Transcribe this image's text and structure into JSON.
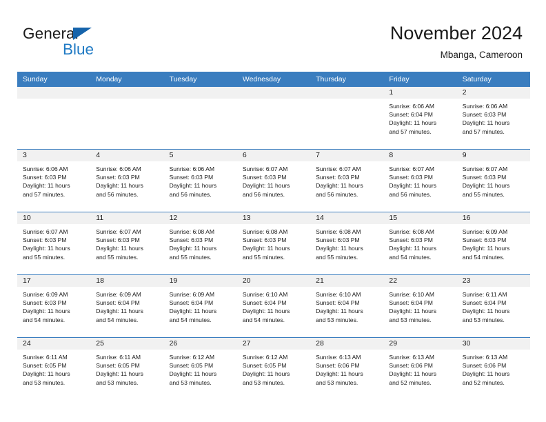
{
  "brand": {
    "name_part1": "General",
    "name_part2": "Blue",
    "triangle_icon": "triangle-icon"
  },
  "header": {
    "title": "November 2024",
    "subtitle": "Mbanga, Cameroon"
  },
  "colors": {
    "header_blue": "#3A7DBF",
    "daynum_band": "#F1F1F1",
    "brand_blue": "#1F7AC4",
    "text": "#1a1a1a"
  },
  "weekdays": [
    "Sunday",
    "Monday",
    "Tuesday",
    "Wednesday",
    "Thursday",
    "Friday",
    "Saturday"
  ],
  "weeks": [
    [
      {
        "day": "",
        "empty": true
      },
      {
        "day": "",
        "empty": true
      },
      {
        "day": "",
        "empty": true
      },
      {
        "day": "",
        "empty": true
      },
      {
        "day": "",
        "empty": true
      },
      {
        "day": "1",
        "sunrise": "Sunrise: 6:06 AM",
        "sunset": "Sunset: 6:04 PM",
        "daylight_line1": "Daylight: 11 hours",
        "daylight_line2": "and 57 minutes."
      },
      {
        "day": "2",
        "sunrise": "Sunrise: 6:06 AM",
        "sunset": "Sunset: 6:03 PM",
        "daylight_line1": "Daylight: 11 hours",
        "daylight_line2": "and 57 minutes."
      }
    ],
    [
      {
        "day": "3",
        "sunrise": "Sunrise: 6:06 AM",
        "sunset": "Sunset: 6:03 PM",
        "daylight_line1": "Daylight: 11 hours",
        "daylight_line2": "and 57 minutes."
      },
      {
        "day": "4",
        "sunrise": "Sunrise: 6:06 AM",
        "sunset": "Sunset: 6:03 PM",
        "daylight_line1": "Daylight: 11 hours",
        "daylight_line2": "and 56 minutes."
      },
      {
        "day": "5",
        "sunrise": "Sunrise: 6:06 AM",
        "sunset": "Sunset: 6:03 PM",
        "daylight_line1": "Daylight: 11 hours",
        "daylight_line2": "and 56 minutes."
      },
      {
        "day": "6",
        "sunrise": "Sunrise: 6:07 AM",
        "sunset": "Sunset: 6:03 PM",
        "daylight_line1": "Daylight: 11 hours",
        "daylight_line2": "and 56 minutes."
      },
      {
        "day": "7",
        "sunrise": "Sunrise: 6:07 AM",
        "sunset": "Sunset: 6:03 PM",
        "daylight_line1": "Daylight: 11 hours",
        "daylight_line2": "and 56 minutes."
      },
      {
        "day": "8",
        "sunrise": "Sunrise: 6:07 AM",
        "sunset": "Sunset: 6:03 PM",
        "daylight_line1": "Daylight: 11 hours",
        "daylight_line2": "and 56 minutes."
      },
      {
        "day": "9",
        "sunrise": "Sunrise: 6:07 AM",
        "sunset": "Sunset: 6:03 PM",
        "daylight_line1": "Daylight: 11 hours",
        "daylight_line2": "and 55 minutes."
      }
    ],
    [
      {
        "day": "10",
        "sunrise": "Sunrise: 6:07 AM",
        "sunset": "Sunset: 6:03 PM",
        "daylight_line1": "Daylight: 11 hours",
        "daylight_line2": "and 55 minutes."
      },
      {
        "day": "11",
        "sunrise": "Sunrise: 6:07 AM",
        "sunset": "Sunset: 6:03 PM",
        "daylight_line1": "Daylight: 11 hours",
        "daylight_line2": "and 55 minutes."
      },
      {
        "day": "12",
        "sunrise": "Sunrise: 6:08 AM",
        "sunset": "Sunset: 6:03 PM",
        "daylight_line1": "Daylight: 11 hours",
        "daylight_line2": "and 55 minutes."
      },
      {
        "day": "13",
        "sunrise": "Sunrise: 6:08 AM",
        "sunset": "Sunset: 6:03 PM",
        "daylight_line1": "Daylight: 11 hours",
        "daylight_line2": "and 55 minutes."
      },
      {
        "day": "14",
        "sunrise": "Sunrise: 6:08 AM",
        "sunset": "Sunset: 6:03 PM",
        "daylight_line1": "Daylight: 11 hours",
        "daylight_line2": "and 55 minutes."
      },
      {
        "day": "15",
        "sunrise": "Sunrise: 6:08 AM",
        "sunset": "Sunset: 6:03 PM",
        "daylight_line1": "Daylight: 11 hours",
        "daylight_line2": "and 54 minutes."
      },
      {
        "day": "16",
        "sunrise": "Sunrise: 6:09 AM",
        "sunset": "Sunset: 6:03 PM",
        "daylight_line1": "Daylight: 11 hours",
        "daylight_line2": "and 54 minutes."
      }
    ],
    [
      {
        "day": "17",
        "sunrise": "Sunrise: 6:09 AM",
        "sunset": "Sunset: 6:03 PM",
        "daylight_line1": "Daylight: 11 hours",
        "daylight_line2": "and 54 minutes."
      },
      {
        "day": "18",
        "sunrise": "Sunrise: 6:09 AM",
        "sunset": "Sunset: 6:04 PM",
        "daylight_line1": "Daylight: 11 hours",
        "daylight_line2": "and 54 minutes."
      },
      {
        "day": "19",
        "sunrise": "Sunrise: 6:09 AM",
        "sunset": "Sunset: 6:04 PM",
        "daylight_line1": "Daylight: 11 hours",
        "daylight_line2": "and 54 minutes."
      },
      {
        "day": "20",
        "sunrise": "Sunrise: 6:10 AM",
        "sunset": "Sunset: 6:04 PM",
        "daylight_line1": "Daylight: 11 hours",
        "daylight_line2": "and 54 minutes."
      },
      {
        "day": "21",
        "sunrise": "Sunrise: 6:10 AM",
        "sunset": "Sunset: 6:04 PM",
        "daylight_line1": "Daylight: 11 hours",
        "daylight_line2": "and 53 minutes."
      },
      {
        "day": "22",
        "sunrise": "Sunrise: 6:10 AM",
        "sunset": "Sunset: 6:04 PM",
        "daylight_line1": "Daylight: 11 hours",
        "daylight_line2": "and 53 minutes."
      },
      {
        "day": "23",
        "sunrise": "Sunrise: 6:11 AM",
        "sunset": "Sunset: 6:04 PM",
        "daylight_line1": "Daylight: 11 hours",
        "daylight_line2": "and 53 minutes."
      }
    ],
    [
      {
        "day": "24",
        "sunrise": "Sunrise: 6:11 AM",
        "sunset": "Sunset: 6:05 PM",
        "daylight_line1": "Daylight: 11 hours",
        "daylight_line2": "and 53 minutes."
      },
      {
        "day": "25",
        "sunrise": "Sunrise: 6:11 AM",
        "sunset": "Sunset: 6:05 PM",
        "daylight_line1": "Daylight: 11 hours",
        "daylight_line2": "and 53 minutes."
      },
      {
        "day": "26",
        "sunrise": "Sunrise: 6:12 AM",
        "sunset": "Sunset: 6:05 PM",
        "daylight_line1": "Daylight: 11 hours",
        "daylight_line2": "and 53 minutes."
      },
      {
        "day": "27",
        "sunrise": "Sunrise: 6:12 AM",
        "sunset": "Sunset: 6:05 PM",
        "daylight_line1": "Daylight: 11 hours",
        "daylight_line2": "and 53 minutes."
      },
      {
        "day": "28",
        "sunrise": "Sunrise: 6:13 AM",
        "sunset": "Sunset: 6:06 PM",
        "daylight_line1": "Daylight: 11 hours",
        "daylight_line2": "and 53 minutes."
      },
      {
        "day": "29",
        "sunrise": "Sunrise: 6:13 AM",
        "sunset": "Sunset: 6:06 PM",
        "daylight_line1": "Daylight: 11 hours",
        "daylight_line2": "and 52 minutes."
      },
      {
        "day": "30",
        "sunrise": "Sunrise: 6:13 AM",
        "sunset": "Sunset: 6:06 PM",
        "daylight_line1": "Daylight: 11 hours",
        "daylight_line2": "and 52 minutes."
      }
    ]
  ]
}
